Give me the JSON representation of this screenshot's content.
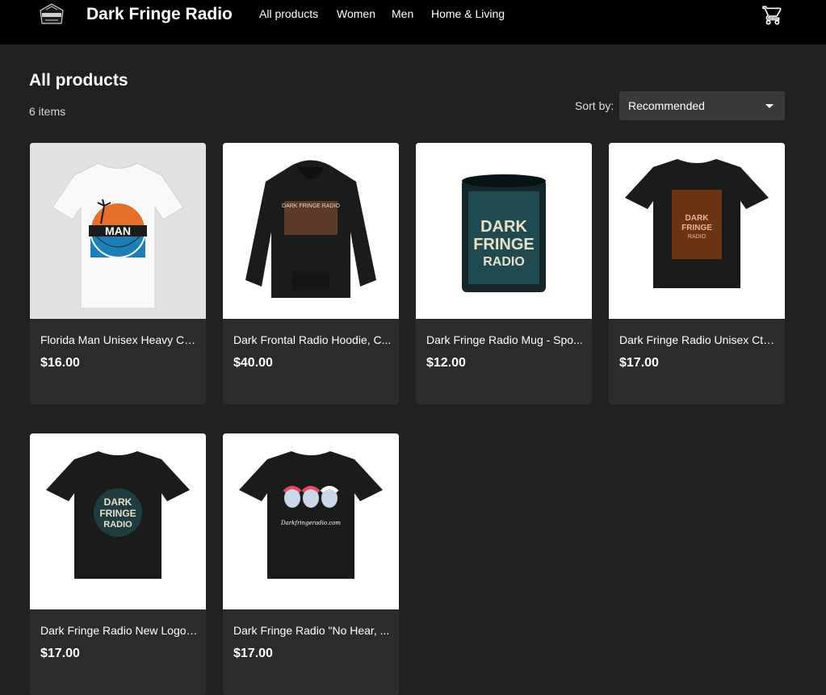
{
  "header": {
    "brand": "Dark Fringe Radio",
    "logo_icon": "dark-fringe-logo",
    "nav": [
      {
        "label": "All products"
      },
      {
        "label": "Women"
      },
      {
        "label": "Men"
      },
      {
        "label": "Home & Living"
      }
    ],
    "cart_icon": "shopping-cart-icon"
  },
  "main": {
    "title": "All products",
    "item_count": "6 items",
    "sort": {
      "label": "Sort by:",
      "value": "Recommended"
    },
    "products": [
      {
        "title": "Florida Man Unisex Heavy Co...",
        "price": "$16.00",
        "image_text": "FLORIDA MAN"
      },
      {
        "title": "Dark Frontal Radio Hoodie, C...",
        "price": "$40.00",
        "image_text": "DARK FRINGE RADIO"
      },
      {
        "title": "Dark Fringe Radio Mug - Spo...",
        "price": "$12.00",
        "image_text": "DARK FRINGE RADIO"
      },
      {
        "title": "Dark Fringe Radio Unisex Cth...",
        "price": "$17.00",
        "image_text": "DARK FRINGE RADIO"
      },
      {
        "title": "Dark Fringe Radio New Logo ...",
        "price": "$17.00",
        "image_text": "DARK FRINGE RADIO"
      },
      {
        "title": "Dark Fringe Radio \"No Hear, ...",
        "price": "$17.00",
        "image_text": "Darkfringeradio.com"
      }
    ]
  },
  "colors": {
    "background": "#212121",
    "header": "#000000",
    "card": "#2c2c2c",
    "select": "#3a3a3a"
  }
}
